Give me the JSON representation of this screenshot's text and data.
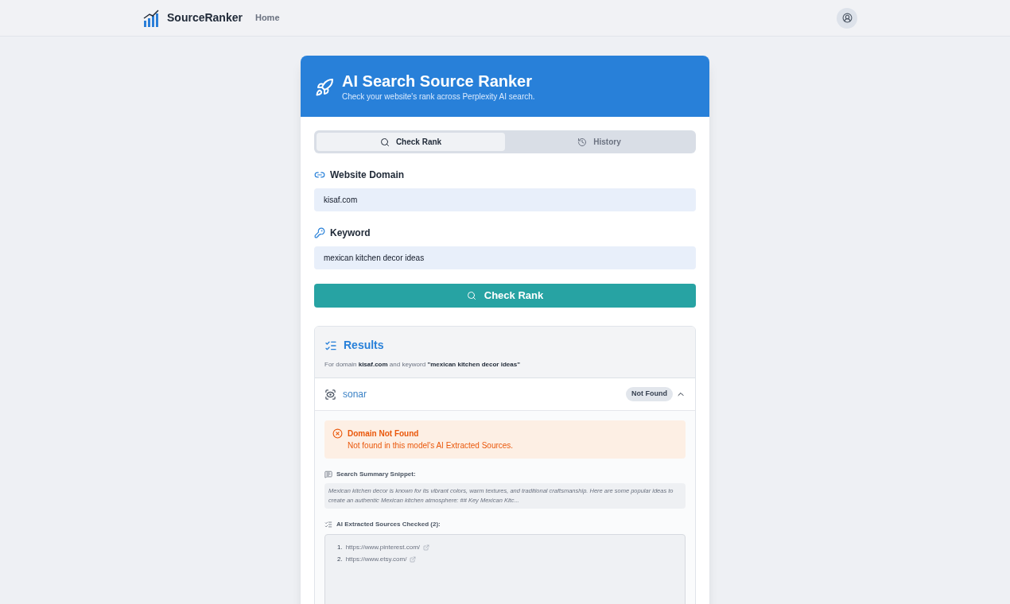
{
  "nav": {
    "brand": "SourceRanker",
    "links": [
      "Home"
    ]
  },
  "header": {
    "title": "AI Search Source Ranker",
    "subtitle": "Check your website's rank across Perplexity AI search."
  },
  "tabs": [
    {
      "label": "Check Rank",
      "kind": "search",
      "selected": true
    },
    {
      "label": "History",
      "kind": "history",
      "selected": false
    }
  ],
  "fields": [
    {
      "label": "Website Domain",
      "kind": "link",
      "value": "kisaf.com"
    },
    {
      "label": "Keyword",
      "kind": "key",
      "value": "mexican kitchen decor ideas"
    }
  ],
  "submit": "Check Rank",
  "results": {
    "title": "Results",
    "description": "For domain **kisaf.com** and keyword **\"mexican kitchen decor ideas\"**",
    "models": [
      {
        "name": "sonar",
        "badge": "Not Found",
        "expanded": true,
        "alert": {
          "title": "Domain Not Found",
          "message": "Not found in this model's AI Extracted Sources."
        },
        "snippet_label": "Search Summary Snippet:",
        "snippet": "Mexican kitchen decor is known for its vibrant colors, warm textures, and traditional craftsmanship. Here are some popular ideas to create an authentic Mexican kitchen atmosphere: ## Key Mexican Kitc...",
        "sources_label": "AI Extracted Sources Checked (2):",
        "sources": [
          {
            "number": "1.",
            "url": "https://www.pinterest.com/"
          },
          {
            "number": "2.",
            "url": "https://www.etsy.com/"
          }
        ]
      }
    ]
  }
}
